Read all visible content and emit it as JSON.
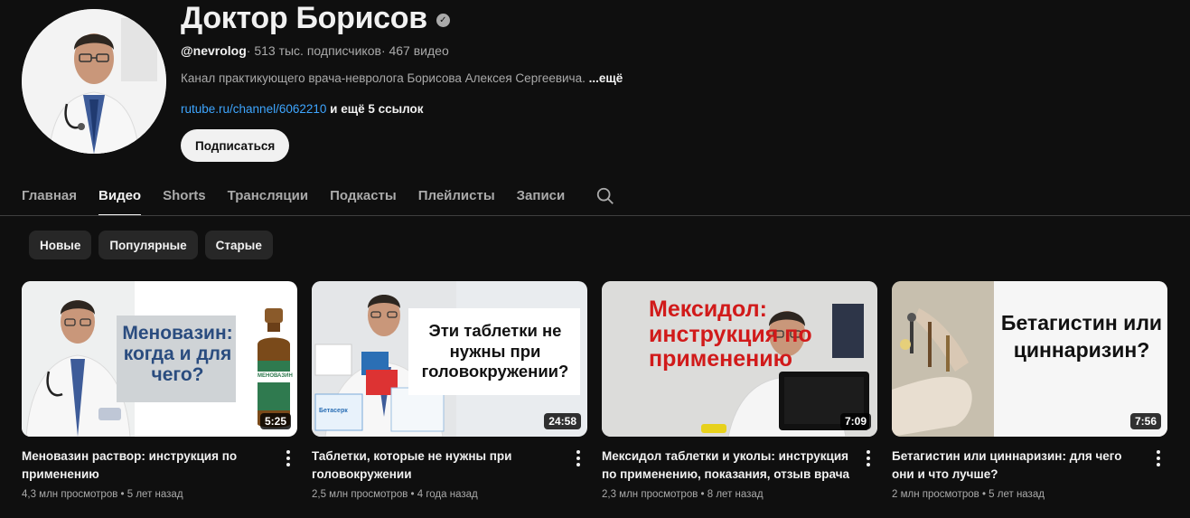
{
  "channel": {
    "title": "Доктор Борисов",
    "handle": "@nevrolog",
    "subscribers": " · 513 тыс. подписчиков",
    "videos": " · 467 видео",
    "description": "Канал практикующего врача-невролога Борисова Алексея Сергеевича. ",
    "description_more": "...ещё",
    "link": "rutube.ru/channel/6062210",
    "link_extra": " и ещё 5 ссылок",
    "subscribe_label": "Подписаться"
  },
  "tabs": [
    {
      "label": "Главная"
    },
    {
      "label": "Видео"
    },
    {
      "label": "Shorts"
    },
    {
      "label": "Трансляции"
    },
    {
      "label": "Подкасты"
    },
    {
      "label": "Плейлисты"
    },
    {
      "label": "Записи"
    }
  ],
  "active_tab": "Видео",
  "chips": [
    {
      "label": "Новые"
    },
    {
      "label": "Популярные"
    },
    {
      "label": "Старые"
    }
  ],
  "videos": [
    {
      "title": "Меновазин раствор: инструкция по применению",
      "views": "4,3 млн просмотров",
      "age": " • 5 лет назад",
      "duration": "5:25",
      "thumb_text": "Меновазин: когда и для чего?",
      "bottle_label": "МЕНОВАЗИН"
    },
    {
      "title": "Таблетки, которые не нужны при головокружении",
      "views": "2,5 млн просмотров",
      "age": " • 4 года назад",
      "duration": "24:58",
      "thumb_text": "Эти таблетки не нужны при головокружении?",
      "box_label": "Бетасерк"
    },
    {
      "title": "Мексидол таблетки и уколы: инструкция по применению, показания, отзыв врача",
      "views": "2,3 млн просмотров",
      "age": " • 8 лет назад",
      "duration": "7:09",
      "thumb_text": "Мексидол: инструкция по применению"
    },
    {
      "title": "Бетагистин или циннаризин: для чего они и что лучше?",
      "views": "2 млн просмотров",
      "age": " • 5 лет назад",
      "duration": "7:56",
      "thumb_text": "Бетагистин или циннаризин?"
    }
  ],
  "colors": {
    "background": "#0f0f0f",
    "link": "#3ea6ff",
    "chip": "#272727",
    "text_secondary": "#aaaaaa",
    "thumb_red_text": "#d11a1a",
    "thumb_blue_text": "#2a4c7f"
  }
}
